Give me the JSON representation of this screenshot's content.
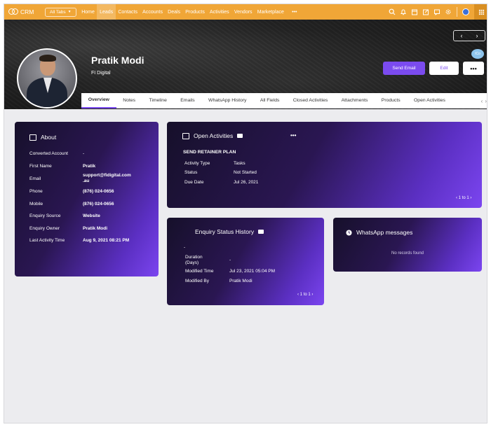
{
  "app": {
    "name": "CRM"
  },
  "topbar": {
    "all_tabs": "All Tabs",
    "nav": [
      "Home",
      "Leads",
      "Contacts",
      "Accounts",
      "Deals",
      "Products",
      "Activities",
      "Vendors",
      "Marketplace"
    ],
    "active_nav": "Leads",
    "more": "•••",
    "icons": [
      "search-icon",
      "bell-icon",
      "calendar-icon",
      "edit-icon",
      "chat-icon",
      "gear-icon",
      "globe-avatar-icon",
      "apps-grid-icon"
    ]
  },
  "record": {
    "name": "Pratik Modi",
    "company": "FI Digital",
    "actions": {
      "send_email": "Send Email",
      "edit": "Edit",
      "more": "•••"
    },
    "badge": "ICo",
    "nav_prev": "‹",
    "nav_next": "›"
  },
  "tabs": {
    "items": [
      "Overview",
      "Notes",
      "Timeline",
      "Emails",
      "WhatsApp History",
      "All Fields",
      "Closed Activities",
      "Attachments",
      "Products",
      "Open Activities"
    ],
    "active": "Overview",
    "prev": "‹",
    "next": "›"
  },
  "about": {
    "title": "About",
    "fields": [
      {
        "label": "Converted Account",
        "value": "-"
      },
      {
        "label": "First Name",
        "value": "Pratik"
      },
      {
        "label": "Email",
        "value": "support@fidigital.com.au",
        "line1": "support@fidigital.com",
        "line2": ".au"
      },
      {
        "label": "Phone",
        "value": "(876) 024-0656"
      },
      {
        "label": "Mobile",
        "value": "(876) 024-0656"
      },
      {
        "label": "Enquiry Source",
        "value": "Website"
      },
      {
        "label": "Enquiry Owner",
        "value": "Pratik Modi"
      },
      {
        "label": "Last Activity Time",
        "value": "Aug 9, 2021 08:21 PM"
      }
    ]
  },
  "open_activities": {
    "title": "Open Activities",
    "more": "•••",
    "item_title": "SEND RETAINER PLAN",
    "fields": [
      {
        "label": "Activity Type",
        "value": "Tasks"
      },
      {
        "label": "Status",
        "value": "Not Started"
      },
      {
        "label": "Due Date",
        "value": "Jul 26, 2021"
      }
    ],
    "pager": "1 to 1"
  },
  "enquiry_status": {
    "title": "Enquiry Status History",
    "dash": "-",
    "fields": [
      {
        "label": "Duration (Days)",
        "line1": "Duration",
        "line2": "(Days)",
        "value": "-"
      },
      {
        "label": "Modified Time",
        "value": "Jul 23, 2021 05:04 PM"
      },
      {
        "label": "Modified By",
        "value": "Pratik Modi"
      }
    ],
    "pager": "1 to 1"
  },
  "whatsapp": {
    "title": "WhatsApp messages",
    "empty": "No records found"
  },
  "colors": {
    "topbar": "#f0a637",
    "accent": "#7b4bef",
    "card_gradient_start": "#16102a",
    "card_gradient_end": "#7b45f0",
    "page_bg": "#ececef"
  }
}
